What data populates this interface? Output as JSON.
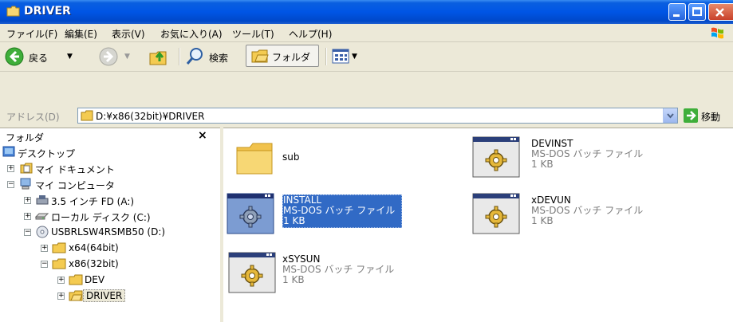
{
  "window": {
    "title": "DRIVER"
  },
  "menu": [
    "ファイル(F)",
    "編集(E)",
    "表示(V)",
    "お気に入り(A)",
    "ツール(T)",
    "ヘルプ(H)"
  ],
  "toolbar": {
    "back_label": "戻る",
    "search_label": "検索",
    "folders_label": "フォルダ"
  },
  "address": {
    "label": "アドレス(D)",
    "value": "D:¥x86(32bit)¥DRIVER",
    "go_label": "移動"
  },
  "folder_pane": {
    "title": "フォルダ",
    "close": "×",
    "tree": [
      {
        "label": "デスクトップ",
        "expander": "",
        "icon": "desktop-icon"
      },
      {
        "label": "マイ ドキュメント",
        "expander": "+",
        "icon": "my-documents-icon"
      },
      {
        "label": "マイ コンピュータ",
        "expander": "−",
        "icon": "my-computer-icon"
      },
      {
        "label": "3.5 インチ FD (A:)",
        "expander": "+",
        "icon": "floppy-drive-icon"
      },
      {
        "label": "ローカル ディスク (C:)",
        "expander": "+",
        "icon": "hard-disk-icon"
      },
      {
        "label": "USBRLSW4RSMB50 (D:)",
        "expander": "−",
        "icon": "cd-drive-icon"
      },
      {
        "label": "x64(64bit)",
        "expander": "+",
        "icon": "folder-icon"
      },
      {
        "label": "x86(32bit)",
        "expander": "−",
        "icon": "folder-icon"
      },
      {
        "label": "DEV",
        "expander": "+",
        "icon": "folder-icon"
      },
      {
        "label": "DRIVER",
        "expander": "+",
        "icon": "open-folder-icon"
      }
    ]
  },
  "files": [
    {
      "name": "sub",
      "type": "",
      "size": "",
      "icon": "folder-icon"
    },
    {
      "name": "DEVINST",
      "type": "MS-DOS バッチ ファイル",
      "size": "1 KB",
      "icon": "batch-file-icon"
    },
    {
      "name": "INSTALL",
      "type": "MS-DOS バッチ ファイル",
      "size": "1 KB",
      "icon": "batch-file-icon",
      "selected": true
    },
    {
      "name": "xDEVUN",
      "type": "MS-DOS バッチ ファイル",
      "size": "1 KB",
      "icon": "batch-file-icon"
    },
    {
      "name": "xSYSUN",
      "type": "MS-DOS バッチ ファイル",
      "size": "1 KB",
      "icon": "batch-file-icon"
    }
  ],
  "colors": {
    "titlebar": "#0055E5",
    "selection": "#316AC5",
    "chrome": "#ECE9D8"
  }
}
